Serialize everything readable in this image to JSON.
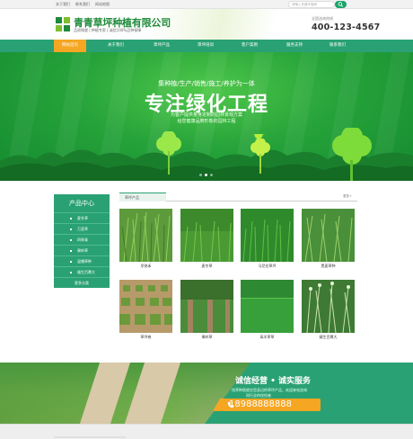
{
  "topbar": {
    "links": [
      "关于我们",
      "联系我们",
      "网站地图"
    ]
  },
  "header": {
    "company": "青青草坪种植有限公司",
    "tagline": "品质铸就 | 种植专家 | 诚信100%品种保障",
    "search_placeholder": "请输入关键字搜索",
    "hotline_label": "全国咨询热线",
    "hotline": "400-123-4567"
  },
  "nav": {
    "items": [
      "网站首页",
      "关于我们",
      "草坪产品",
      "草坪培训",
      "客户案例",
      "服务支持",
      "联系我们"
    ],
    "active": 0
  },
  "banner": {
    "line1": "集种植/生产/销售/施工/养护为一体",
    "title": "专注绿化工程",
    "desc1": "为客户提供量身定制的园林景观方案",
    "desc2": "给您健康品牌形象的园林工程",
    "slide_count": 3,
    "active_slide": 1
  },
  "sidebar": {
    "title": "产品中心",
    "items": [
      "麦冬草",
      "万里草",
      "四季青",
      "果岭草",
      "混播草种",
      "矮生百慕大"
    ],
    "more": "更多分类"
  },
  "products": {
    "tab": "草坪产品",
    "more": "更多+",
    "items": [
      {
        "name": "早熟禾",
        "icon": "grass-clump-image"
      },
      {
        "name": "麦冬草",
        "icon": "lawn-image"
      },
      {
        "name": "马尼拉草坪",
        "icon": "turf-image"
      },
      {
        "name": "黑麦草种",
        "icon": "ryegrass-image"
      },
      {
        "name": "草坪卷",
        "icon": "turf-rolls-image"
      },
      {
        "name": "果岭草",
        "icon": "golf-green-image"
      },
      {
        "name": "高羊茅草",
        "icon": "tall-fescue-image"
      },
      {
        "name": "矮生百慕大",
        "icon": "ornamental-grass-image"
      }
    ]
  },
  "promo": {
    "slogan": "诚信经营 • 诚实服务",
    "sub1": "找草种植就在您身边的草坪产品，欢迎来电咨询",
    "sub2": "同行业的佼佼者",
    "phone": "18988888888"
  },
  "colors": {
    "brand": "#2aa174",
    "accent": "#f5a623",
    "logo_green": "#1f8a3a"
  }
}
